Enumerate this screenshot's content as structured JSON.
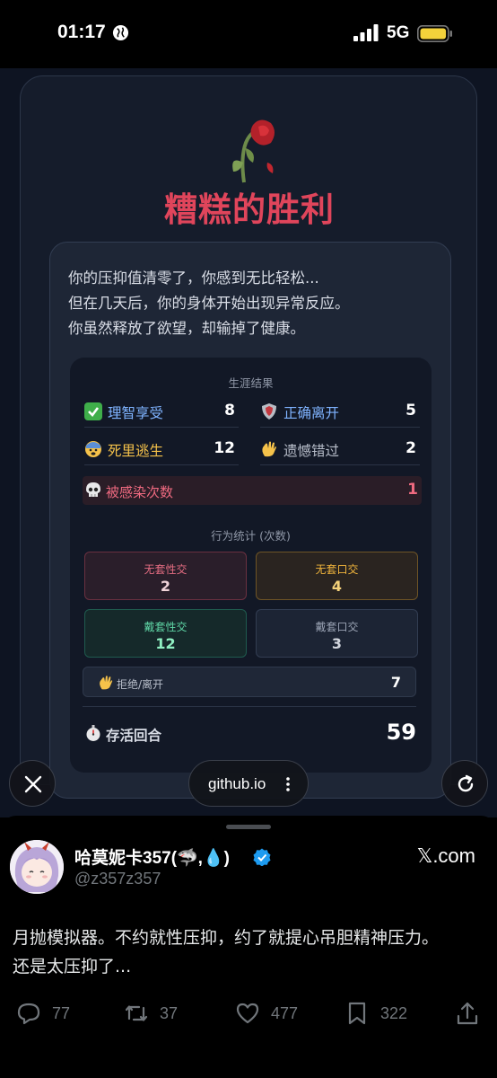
{
  "status_bar": {
    "time": "01:17",
    "network": "5G"
  },
  "game": {
    "title": "糟糕的胜利",
    "story": [
      "你的压抑值清零了，你感到无比轻松...",
      "但在几天后，你的身体开始出现异常反应。",
      "你虽然释放了欲望，却输掉了健康。"
    ],
    "career_title": "生涯结果",
    "career": [
      {
        "icon": "check-icon",
        "label": "理智享受",
        "value": "8",
        "color": "#7fb3ff"
      },
      {
        "icon": "shield-icon",
        "label": "正确离开",
        "value": "5",
        "color": "#7fb3ff"
      },
      {
        "icon": "scared-face-icon",
        "label": "死里逃生",
        "value": "12",
        "color": "#f5c24a"
      },
      {
        "icon": "wave-hand-icon",
        "label": "遗憾错过",
        "value": "2",
        "color": "#b7bdc9"
      }
    ],
    "infect": {
      "label": "被感染次数",
      "value": "1"
    },
    "behavior_title": "行为统计 (次数)",
    "behavior": [
      {
        "label": "无套性交",
        "value": "2"
      },
      {
        "label": "无套口交",
        "value": "4"
      },
      {
        "label": "戴套性交",
        "value": "12"
      },
      {
        "label": "戴套口交",
        "value": "3"
      }
    ],
    "refuse": {
      "label": "拒绝/离开",
      "value": "7"
    },
    "survive": {
      "label": "存活回合",
      "value": "59"
    }
  },
  "browser": {
    "url": "github.io"
  },
  "tweet": {
    "name": "哈莫妮卡357(🦈,💧)",
    "handle": "@z357z357",
    "site": "𝕏.com",
    "text_lines": [
      "月抛模拟器。不约就性压抑，约了就提心吊胆精神压力。",
      "还是太压抑了..."
    ],
    "replies": "77",
    "retweets": "37",
    "likes": "477",
    "bookmarks": "322"
  }
}
